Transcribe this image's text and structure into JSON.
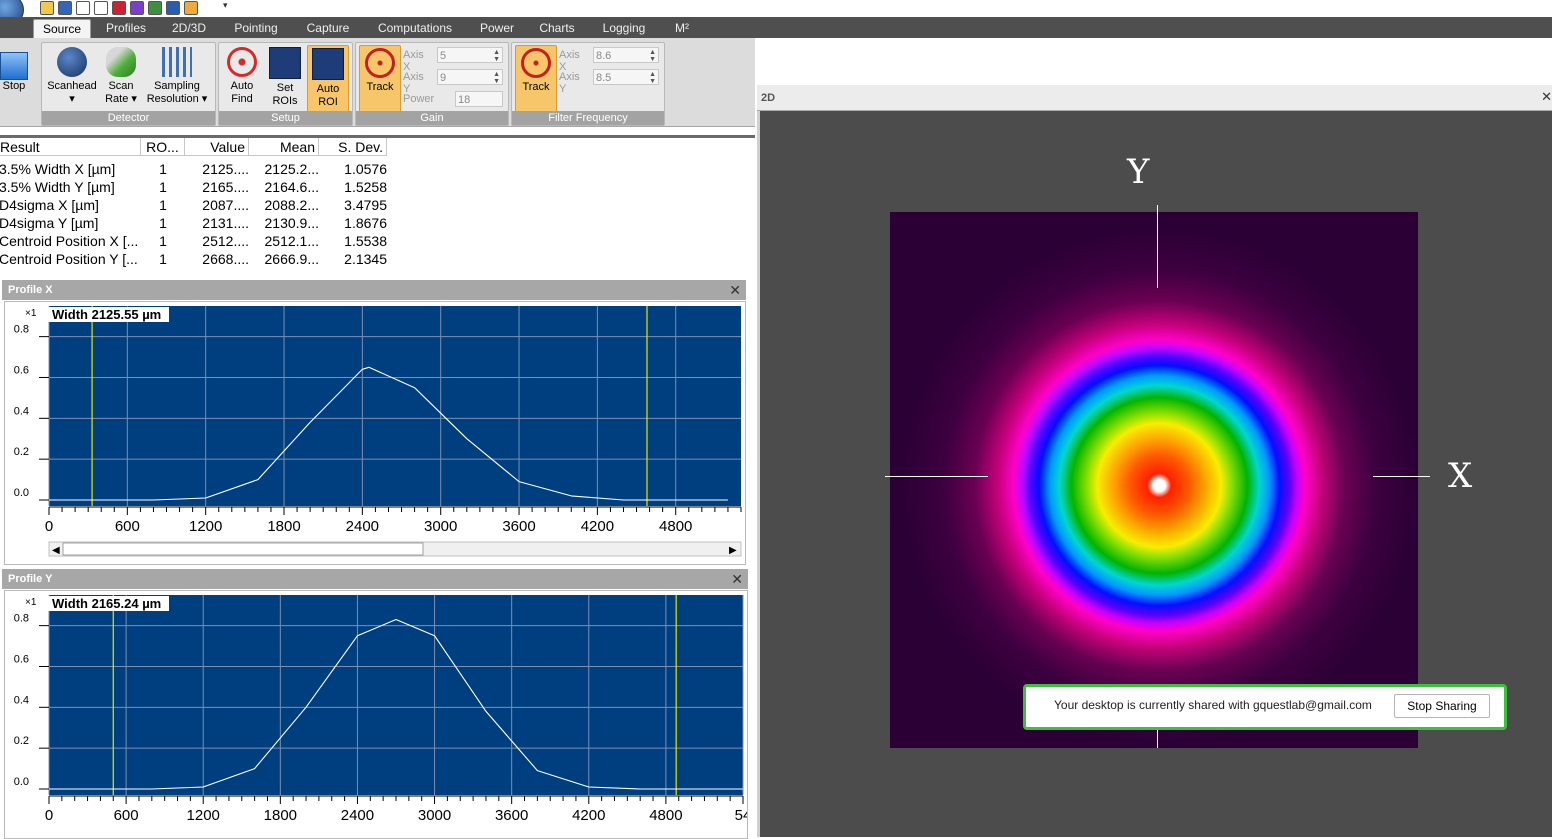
{
  "tabs": [
    "Source",
    "Profiles",
    "2D/3D",
    "Pointing",
    "Capture",
    "Computations",
    "Power",
    "Charts",
    "Logging",
    "M²"
  ],
  "active_tab": "Source",
  "ribbon": {
    "stop_label": "Stop",
    "detector": {
      "label": "Detector",
      "buttons": [
        {
          "line1": "Scanhead",
          "line2": "▾"
        },
        {
          "line1": "Scan",
          "line2": "Rate ▾"
        },
        {
          "line1": "Sampling",
          "line2": "Resolution ▾"
        }
      ]
    },
    "setup": {
      "label": "Setup",
      "buttons": [
        {
          "line1": "Auto",
          "line2": "Find"
        },
        {
          "line1": "Set",
          "line2": "ROIs"
        },
        {
          "line1": "Auto",
          "line2": "ROI"
        }
      ]
    },
    "gain": {
      "label": "Gain",
      "track": "Track",
      "axis_x_label": "Axis X",
      "axis_x": "5",
      "axis_y_label": "Axis Y",
      "axis_y": "9",
      "power_label": "Power",
      "power": "18"
    },
    "filter": {
      "label": "Filter Frequency",
      "track": "Track",
      "axis_x_label": "Axis X",
      "axis_x": "8.6",
      "axis_y_label": "Axis Y",
      "axis_y": "8.5"
    }
  },
  "results": {
    "columns": [
      "Result",
      "RO...",
      "Value",
      "Mean",
      "S. Dev."
    ],
    "rows": [
      [
        "3.5% Width X [µm]",
        "1",
        "2125....",
        "2125.2...",
        "1.0576"
      ],
      [
        "3.5% Width Y [µm]",
        "1",
        "2165....",
        "2164.6...",
        "1.5258"
      ],
      [
        "D4sigma X [µm]",
        "1",
        "2087....",
        "2088.2...",
        "3.4795"
      ],
      [
        "D4sigma Y [µm]",
        "1",
        "2131....",
        "2130.9...",
        "1.8676"
      ],
      [
        "Centroid Position X [...",
        "1",
        "2512....",
        "2512.1...",
        "1.5538"
      ],
      [
        "Centroid Position Y [...",
        "1",
        "2668....",
        "2666.9...",
        "2.1345"
      ]
    ]
  },
  "profile_x": {
    "title": "Profile X",
    "width_label": "Width 2125.55 µm",
    "multiplier": "×1",
    "y_ticks": [
      "0.8",
      "0.6",
      "0.4",
      "0.2",
      "0.0"
    ],
    "x_ticks": [
      "0",
      "600",
      "1200",
      "1800",
      "2400",
      "3000",
      "3600",
      "4200",
      "4800"
    ]
  },
  "profile_y": {
    "title": "Profile Y",
    "width_label": "Width 2165.24 µm",
    "multiplier": "×1",
    "y_ticks": [
      "0.8",
      "0.6",
      "0.4",
      "0.2",
      "0.0"
    ],
    "x_ticks": [
      "0",
      "600",
      "1200",
      "1800",
      "2400",
      "3000",
      "3600",
      "4200",
      "4800",
      "54"
    ]
  },
  "pane_2d": {
    "title": "2D",
    "axis_y": "Y",
    "axis_x": "X"
  },
  "share_banner": {
    "text": "Your desktop is currently shared with gquestlab@gmail.com",
    "button": "Stop Sharing"
  },
  "chart_data": [
    {
      "type": "line",
      "title": "Profile X",
      "annotation": "Width 2125.55 µm",
      "x": [
        0,
        400,
        800,
        1200,
        1600,
        2000,
        2400,
        2450,
        2800,
        3200,
        3600,
        4000,
        4400,
        4800,
        5200
      ],
      "values": [
        0.0,
        0.0,
        0.0,
        0.01,
        0.1,
        0.38,
        0.64,
        0.65,
        0.55,
        0.3,
        0.09,
        0.02,
        0.0,
        0.0,
        0.0
      ],
      "xlim": [
        0,
        5300
      ],
      "ylim": [
        0,
        0.95
      ],
      "cursors_x": [
        330,
        4580
      ],
      "grid": true
    },
    {
      "type": "line",
      "title": "Profile Y",
      "annotation": "Width 2165.24 µm",
      "x": [
        0,
        400,
        800,
        1200,
        1600,
        2000,
        2400,
        2700,
        3000,
        3400,
        3800,
        4200,
        4600,
        5000,
        5400
      ],
      "values": [
        0.0,
        0.0,
        0.0,
        0.01,
        0.1,
        0.4,
        0.75,
        0.83,
        0.75,
        0.38,
        0.09,
        0.01,
        0.0,
        0.0,
        0.0
      ],
      "xlim": [
        0,
        5400
      ],
      "ylim": [
        0,
        0.95
      ],
      "cursors_x": [
        500,
        4880
      ],
      "grid": true
    }
  ]
}
